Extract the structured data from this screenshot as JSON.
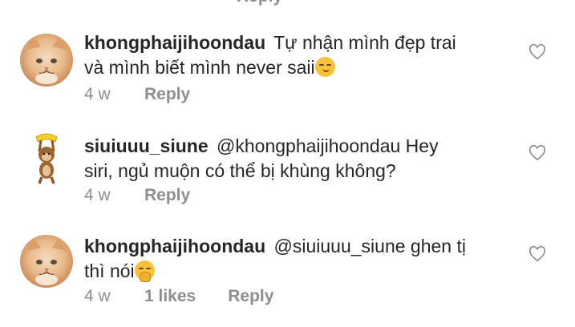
{
  "partial_top": {
    "reply": "Reply"
  },
  "comments": [
    {
      "username": "khongphaijihoondau",
      "text": "Tự nhận mình đẹp trai và mình biết mình never saii",
      "line1": "Tự nhận mình đẹp trai",
      "line2": "và mình biết mình never saii",
      "emoji": "smirking-face",
      "time": "4 w",
      "likes": "",
      "reply": "Reply"
    },
    {
      "username": "siuiuuu_siune",
      "text": "@khongphaijihoondau Hey siri, ngủ muộn có thể bị khùng không?",
      "line1": "@khongphaijihoondau Hey",
      "line2": "siri, ngủ muộn có thể bị khùng không?",
      "time": "4 w",
      "likes": "",
      "reply": "Reply"
    },
    {
      "username": "khongphaijihoondau",
      "text": "@siuiuuu_siune ghen tị thì nói",
      "line1": "@siuiuuu_siune ghen tị",
      "line2": "thì nói",
      "emoji": "shushing-face",
      "time": "4 w",
      "likes": "1 likes",
      "reply": "Reply"
    }
  ]
}
